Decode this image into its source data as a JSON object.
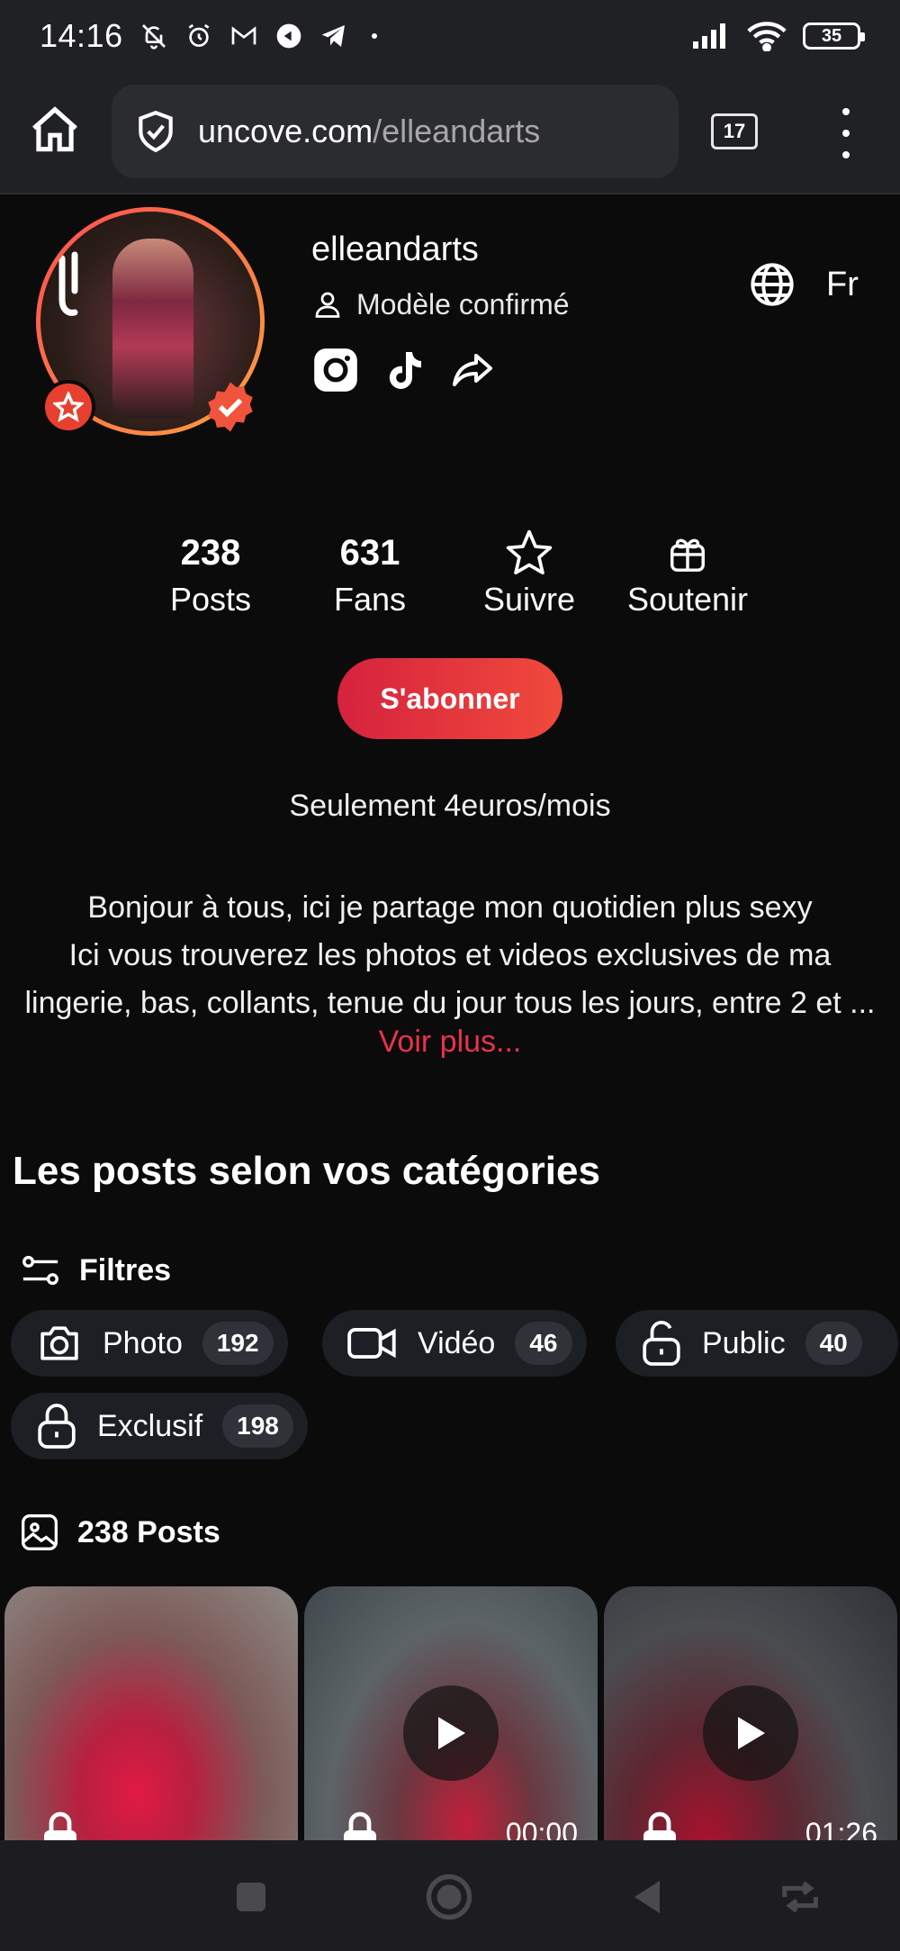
{
  "status_bar": {
    "time": "14:16",
    "battery": "35"
  },
  "browser": {
    "domain": "uncove.com",
    "path": "/elleandarts",
    "tab_count": "17"
  },
  "profile": {
    "username": "elleandarts",
    "model_label": "Modèle confirmé",
    "language": "Fr"
  },
  "stats": {
    "posts_count": "238",
    "posts_label": "Posts",
    "fans_count": "631",
    "fans_label": "Fans",
    "follow_label": "Suivre",
    "support_label": "Soutenir"
  },
  "subscribe": {
    "button_label": "S'abonner",
    "price_text": "Seulement 4euros/mois"
  },
  "bio": {
    "line1": "Bonjour à tous, ici je partage  mon quotidien plus sexy",
    "line2": "Ici vous trouverez les photos et videos exclusives de ma",
    "line3": "lingerie, bas, collants, tenue du jour tous les jours, entre 2 et ...",
    "see_more": "Voir plus..."
  },
  "categories": {
    "title": "Les posts selon vos catégories",
    "filters_label": "Filtres",
    "chips": [
      {
        "label": "Photo",
        "count": "192",
        "icon": "camera-icon"
      },
      {
        "label": "Vidéo",
        "count": "46",
        "icon": "video-icon"
      },
      {
        "label": "Public",
        "count": "40",
        "icon": "unlock-icon"
      },
      {
        "label": "Exclusif",
        "count": "198",
        "icon": "lock-icon"
      }
    ]
  },
  "posts": {
    "header": "238 Posts",
    "items": [
      {
        "type": "photo",
        "duration": ""
      },
      {
        "type": "video",
        "duration": "00:00"
      },
      {
        "type": "video",
        "duration": "01:26"
      }
    ]
  },
  "colors": {
    "accent": "#e8324c",
    "background": "#0b0b0c",
    "chip_bg": "#1c1f23"
  }
}
